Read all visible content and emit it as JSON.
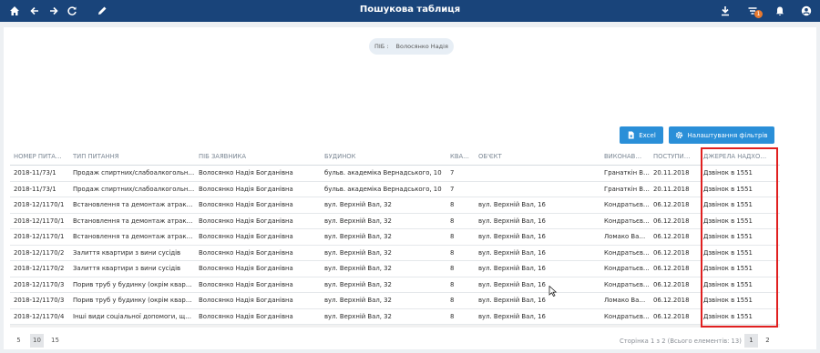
{
  "header": {
    "title": "Пошукова таблиця",
    "badge_count": "1",
    "icons": [
      "home-icon",
      "back-arrow-icon",
      "forward-arrow-icon",
      "refresh-icon",
      "pencil-icon",
      "download-icon",
      "filter-list-icon",
      "bell-icon",
      "user-account-icon"
    ]
  },
  "filter_chip": {
    "label": "ПІБ :",
    "value": "Волосянко Надія"
  },
  "toolbar": {
    "excel_label": "Excel",
    "filter_settings_label": "Налаштування фільтрів"
  },
  "table": {
    "columns": [
      "НОМЕР ПИТА…",
      "ТИП ПИТАННЯ",
      "ПІБ ЗАЯВНИКА",
      "БУДИНОК",
      "КВА…",
      "ОБ'ЄКТ",
      "ВИКОНАВ…",
      "ПОСТУПИ…",
      "ДЖЕРЕЛА НАДХО…"
    ],
    "rows": [
      [
        "2018-11/73/1",
        "Продаж спиртних/слабоалкогольн…",
        "Волосянко Надія Богданівна",
        "бульв. академіка Вернадського, 10",
        "7",
        "",
        "Гранаткін В…",
        "20.11.2018",
        "Дзвінок в 1551"
      ],
      [
        "2018-11/73/1",
        "Продаж спиртних/слабоалкогольн…",
        "Волосянко Надія Богданівна",
        "бульв. академіка Вернадського, 10",
        "7",
        "",
        "Гранаткін В…",
        "20.11.2018",
        "Дзвінок в 1551"
      ],
      [
        "2018-12/1170/1",
        "Встановлення та демонтаж атракці…",
        "Волосянко Надія Богданівна",
        "вул. Верхній Вал, 32",
        "8",
        "вул. Верхній Вал, 16",
        "Кондратьєв…",
        "06.12.2018",
        "Дзвінок в 1551"
      ],
      [
        "2018-12/1170/1",
        "Встановлення та демонтаж атракці…",
        "Волосянко Надія Богданівна",
        "вул. Верхній Вал, 32",
        "8",
        "вул. Верхній Вал, 16",
        "Кондратьєв…",
        "06.12.2018",
        "Дзвінок в 1551"
      ],
      [
        "2018-12/1170/1",
        "Встановлення та демонтаж атракці…",
        "Волосянко Надія Богданівна",
        "вул. Верхній Вал, 32",
        "8",
        "вул. Верхній Вал, 16",
        "Ломако Ва…",
        "06.12.2018",
        "Дзвінок в 1551"
      ],
      [
        "2018-12/1170/2",
        "Залиття квартири з вини сусідів",
        "Волосянко Надія Богданівна",
        "вул. Верхній Вал, 32",
        "8",
        "вул. Верхній Вал, 16",
        "Кондратьєв…",
        "06.12.2018",
        "Дзвінок в 1551"
      ],
      [
        "2018-12/1170/2",
        "Залиття квартири з вини сусідів",
        "Волосянко Надія Богданівна",
        "вул. Верхній Вал, 32",
        "8",
        "вул. Верхній Вал, 16",
        "Кондратьєв…",
        "06.12.2018",
        "Дзвінок в 1551"
      ],
      [
        "2018-12/1170/3",
        "Порив труб у будинку (окрім квар…",
        "Волосянко Надія Богданівна",
        "вул. Верхній Вал, 32",
        "8",
        "вул. Верхній Вал, 16",
        "Кондратьєв…",
        "06.12.2018",
        "Дзвінок в 1551"
      ],
      [
        "2018-12/1170/3",
        "Порив труб у будинку (окрім квар…",
        "Волосянко Надія Богданівна",
        "вул. Верхній Вал, 32",
        "8",
        "вул. Верхній Вал, 16",
        "Ломако Ва…",
        "06.12.2018",
        "Дзвінок в 1551"
      ],
      [
        "2018-12/1170/4",
        "Інші види соціальної допомоги, щ…",
        "Волосянко Надія Богданівна",
        "вул. Верхній Вал, 32",
        "8",
        "вул. Верхній Вал, 16",
        "Кондратьєв…",
        "06.12.2018",
        "Дзвінок в 1551"
      ]
    ]
  },
  "pager": {
    "sizes": [
      "5",
      "10",
      "15"
    ],
    "active_size": "10",
    "info": "Сторінка 1 з 2 (Всього елементів: 13)",
    "pages": [
      "1",
      "2"
    ],
    "active_page": "1"
  },
  "colors": {
    "topbar": "#19447a",
    "button": "#2a8fd8",
    "highlight": "#e02020",
    "badge": "#e8792f"
  }
}
